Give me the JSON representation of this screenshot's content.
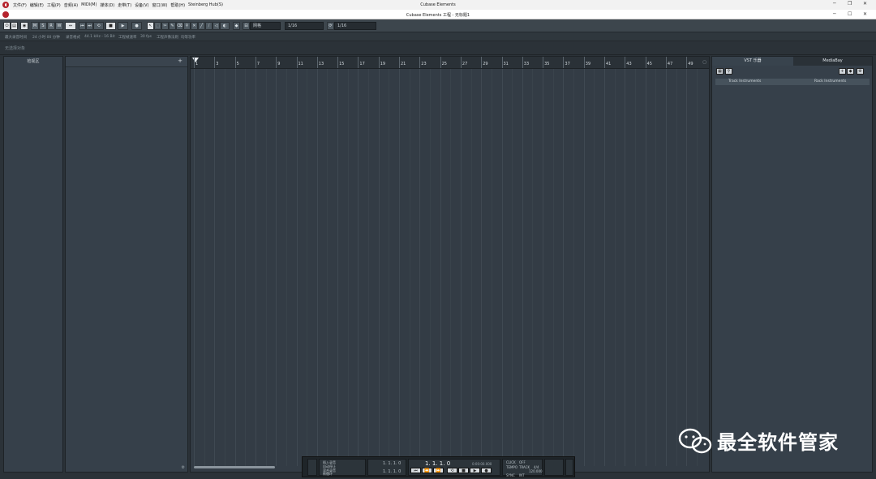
{
  "app_title": "Cubase Elements",
  "window_title": "Cubase Elements 工程 - 无标题1",
  "menu": [
    "文件(F)",
    "编辑(E)",
    "工程(P)",
    "音频(A)",
    "MIDI(M)",
    "媒体(D)",
    "走带(T)",
    "设备(V)",
    "窗口(W)",
    "帮助(H)",
    "Steinberg Hub(S)"
  ],
  "toolbar": {
    "m": "M",
    "s": "S",
    "r": "R",
    "w": "W",
    "snap_type": "网格",
    "quantize": "1/16",
    "quantize2": "1/16"
  },
  "info_line": {
    "max_record": "最大录音时间",
    "max_record_val": "24 小时 00 分钟",
    "sample_rate_label": "录音格式",
    "sample_rate_val": "44.1 kHz - 16 Bit",
    "frame_label": "工程帧速率",
    "frame_val": "30 fps",
    "pan_label": "工程声像法则",
    "pan_val": "均等功率"
  },
  "no_selection": "无选择对象",
  "inspector_title": "检视区",
  "add_track": "+",
  "ruler_ticks": [
    "1",
    "3",
    "5",
    "7",
    "9",
    "11",
    "13",
    "15",
    "17",
    "19",
    "21",
    "23",
    "25",
    "27",
    "29",
    "31",
    "33",
    "35",
    "37",
    "39",
    "41",
    "43",
    "45",
    "47",
    "49"
  ],
  "right_zone": {
    "tab_vst": "VST 乐器",
    "tab_media": "MediaBay",
    "track_instruments": "Track Instruments",
    "rack_instruments": "Rack Instruments"
  },
  "transport": {
    "punch_in": "插入录音",
    "auto_punch": "自动停止",
    "record_mode": "混合录音",
    "rec_mode2": "新循环",
    "pos1": "1. 1. 1. 0",
    "pos2": "1. 1. 1. 0",
    "main_pos": "1. 1. 1. 0",
    "timecode": "0:00:00.000",
    "click": "CLICK",
    "click_state": "OFF",
    "tempo": "TEMPO",
    "tempo_label": "TRACK",
    "sync": "SYNC",
    "sync_state": "INT",
    "sig": "4/4",
    "bpm": "120.000"
  },
  "watermark": "最全软件管家",
  "colors": {
    "background": "#2b3238",
    "panel": "#36404a",
    "logo": "#b5232d"
  }
}
